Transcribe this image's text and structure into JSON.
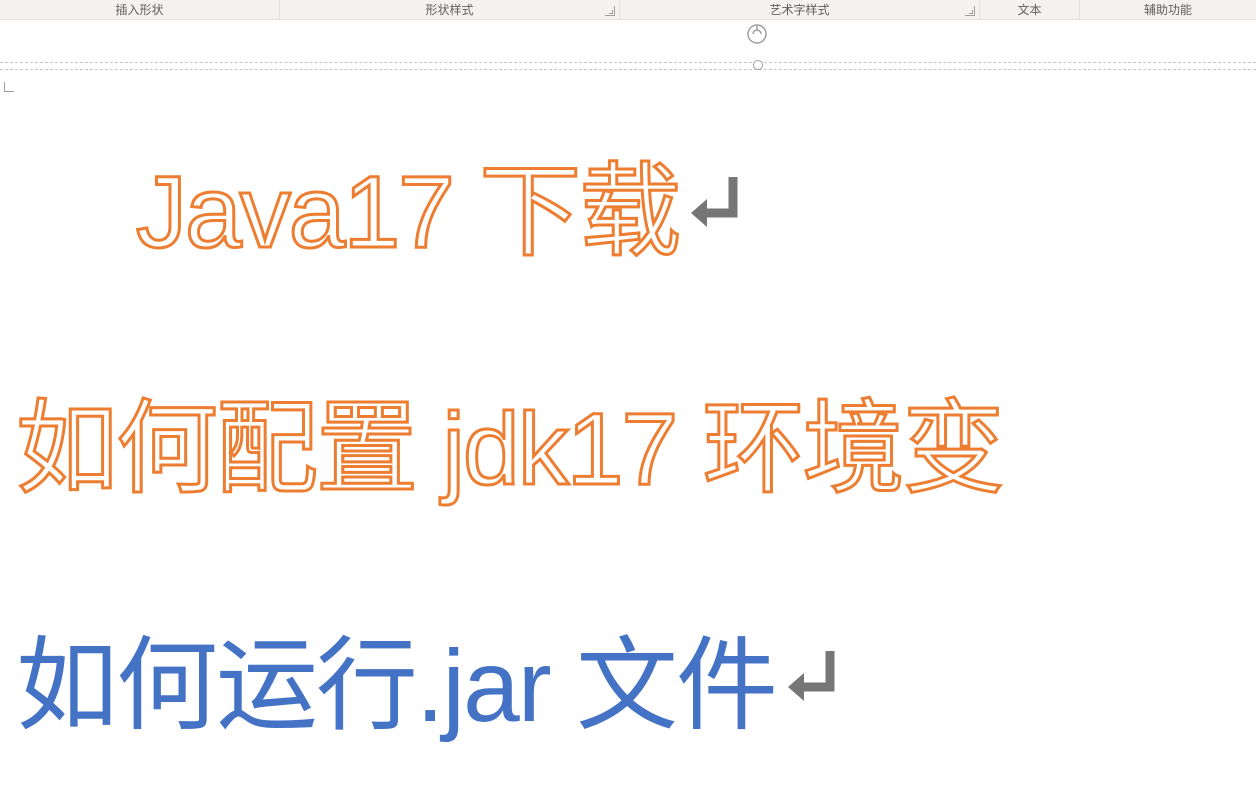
{
  "ribbon": {
    "group1": "插入形状",
    "group2": "形状样式",
    "group3": "艺术字样式",
    "group4": "文本",
    "group5": "辅助功能"
  },
  "document": {
    "line1": "Java17 下载",
    "line2": "如何配置 jdk17 环境变",
    "line3": "如何运行.jar 文件"
  }
}
